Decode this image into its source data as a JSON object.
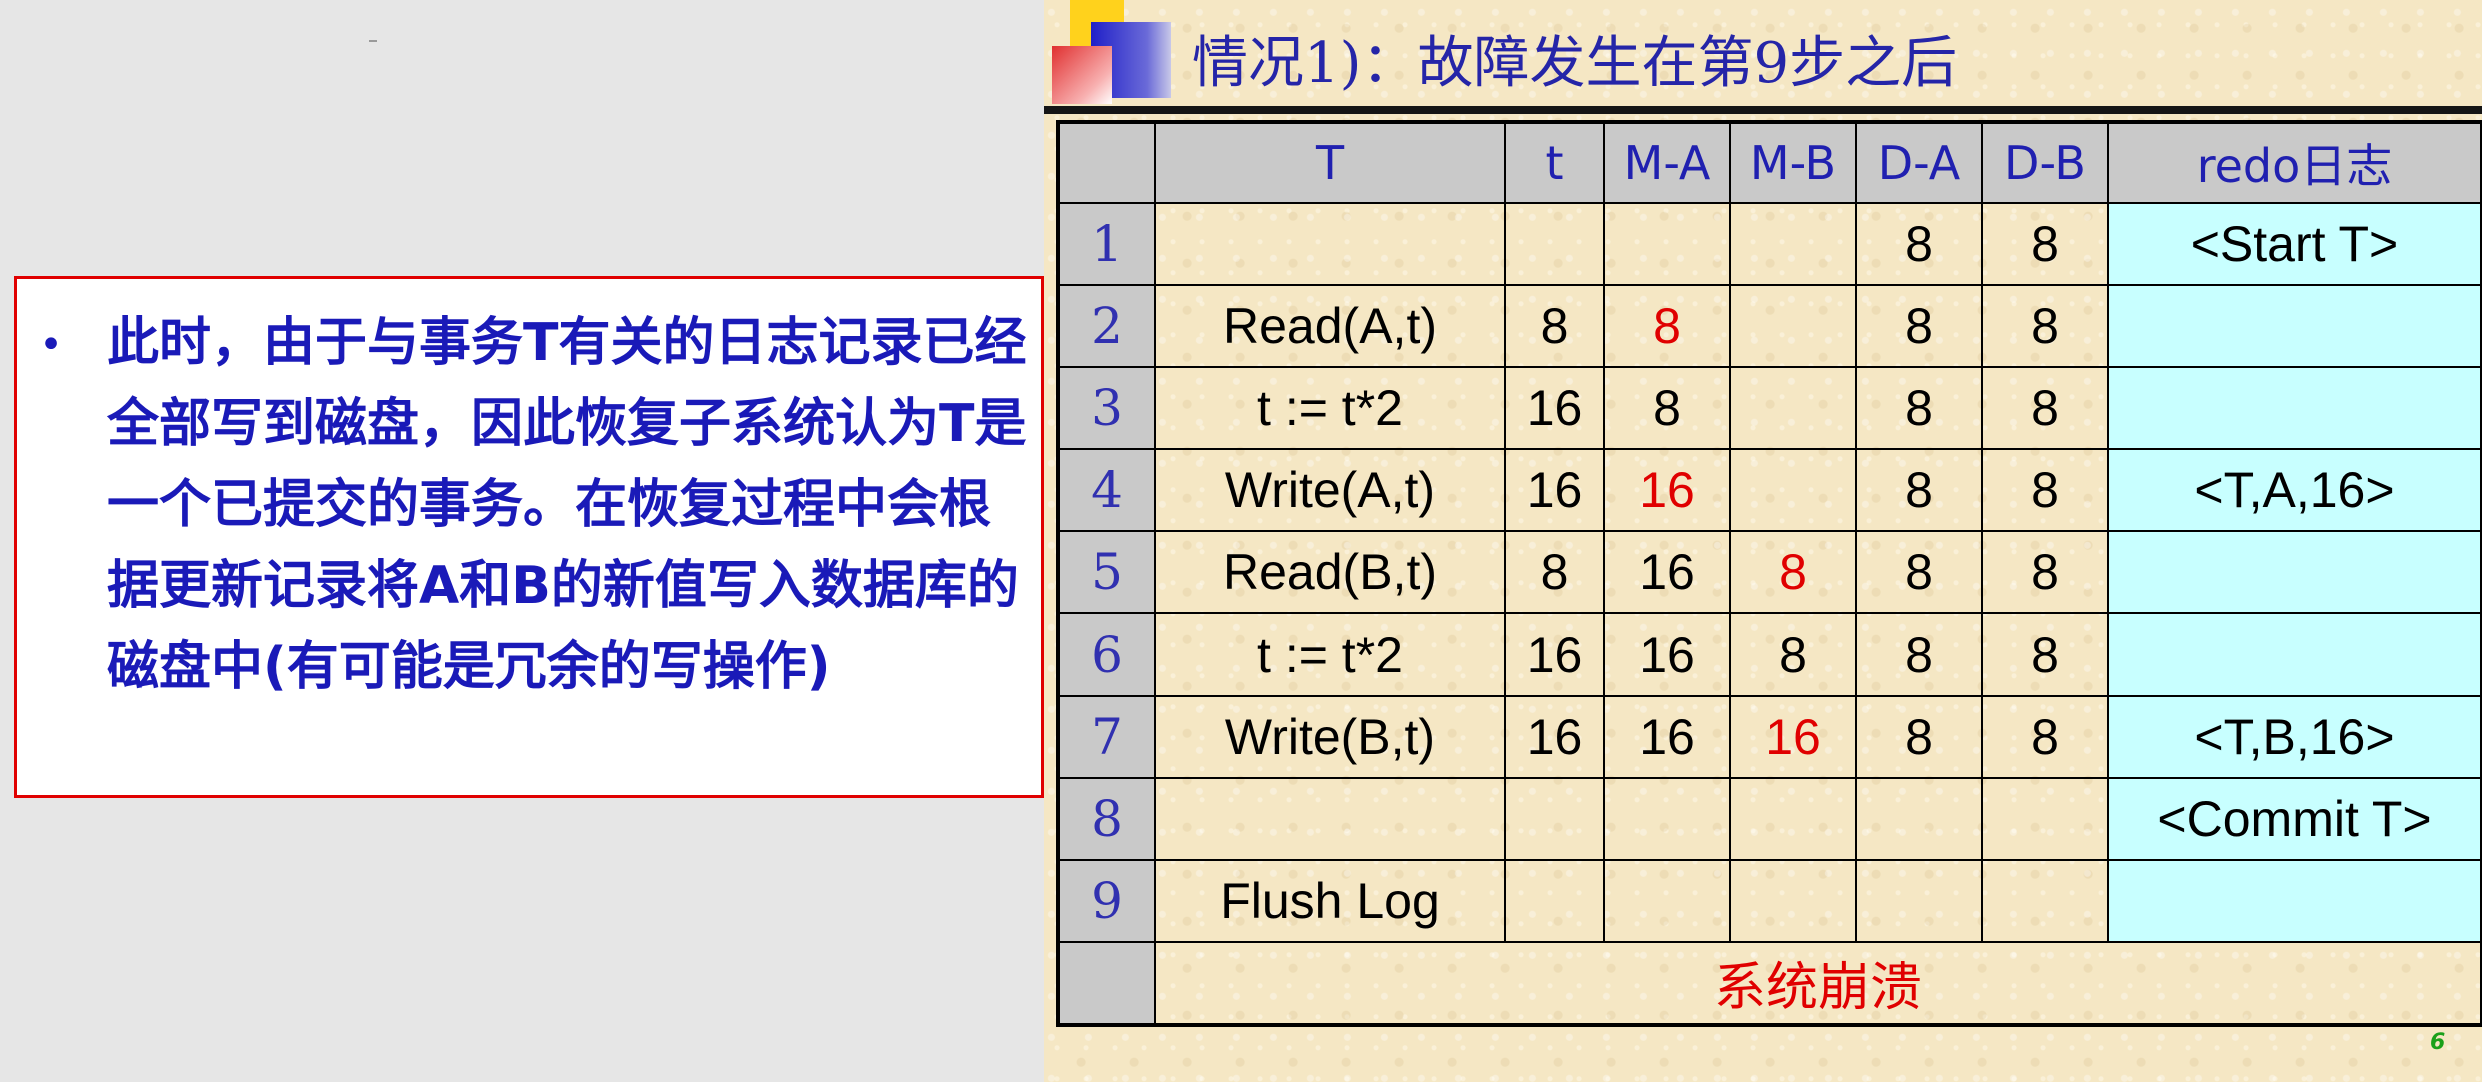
{
  "note": {
    "bullet": "•",
    "text": "此时，由于与事务T有关的日志记录已经全部写到磁盘，因此恢复子系统认为T是一个已提交的事务。在恢复过程中会根据更新记录将A和B的新值写入数据库的磁盘中(有可能是冗余的写操作)"
  },
  "slide": {
    "title": "情况1)：故障发生在第9步之后",
    "page_number": "6"
  },
  "table": {
    "headers": [
      "",
      "T",
      "t",
      "M-A",
      "M-B",
      "D-A",
      "D-B",
      "redo日志"
    ],
    "rows": [
      {
        "num": "1",
        "T": "",
        "t": "",
        "MA": "",
        "MB": "",
        "DA": "8",
        "DB": "8",
        "redo": "<Start T>"
      },
      {
        "num": "2",
        "T": "Read(A,t)",
        "t": "8",
        "MA": "8",
        "MB": "",
        "DA": "8",
        "DB": "8",
        "redo": ""
      },
      {
        "num": "3",
        "T": "t := t*2",
        "t": "16",
        "MA": "8",
        "MB": "",
        "DA": "8",
        "DB": "8",
        "redo": ""
      },
      {
        "num": "4",
        "T": "Write(A,t)",
        "t": "16",
        "MA": "16",
        "MB": "",
        "DA": "8",
        "DB": "8",
        "redo": "<T,A,16>"
      },
      {
        "num": "5",
        "T": "Read(B,t)",
        "t": "8",
        "MA": "16",
        "MB": "8",
        "DA": "8",
        "DB": "8",
        "redo": ""
      },
      {
        "num": "6",
        "T": "t := t*2",
        "t": "16",
        "MA": "16",
        "MB": "8",
        "DA": "8",
        "DB": "8",
        "redo": ""
      },
      {
        "num": "7",
        "T": "Write(B,t)",
        "t": "16",
        "MA": "16",
        "MB": "16",
        "DA": "8",
        "DB": "8",
        "redo": "<T,B,16>"
      },
      {
        "num": "8",
        "T": "",
        "t": "",
        "MA": "",
        "MB": "",
        "DA": "",
        "DB": "",
        "redo": "<Commit T>"
      },
      {
        "num": "9",
        "T": "Flush Log",
        "t": "",
        "MA": "",
        "MB": "",
        "DA": "",
        "DB": "",
        "redo": ""
      }
    ],
    "crash_label": "系统崩溃"
  },
  "colors": {
    "accent_blue": "#1a1ab8",
    "highlight_red": "#e00000",
    "redo_cell": "#c8ffff",
    "header_gray": "#c9c9c9"
  }
}
